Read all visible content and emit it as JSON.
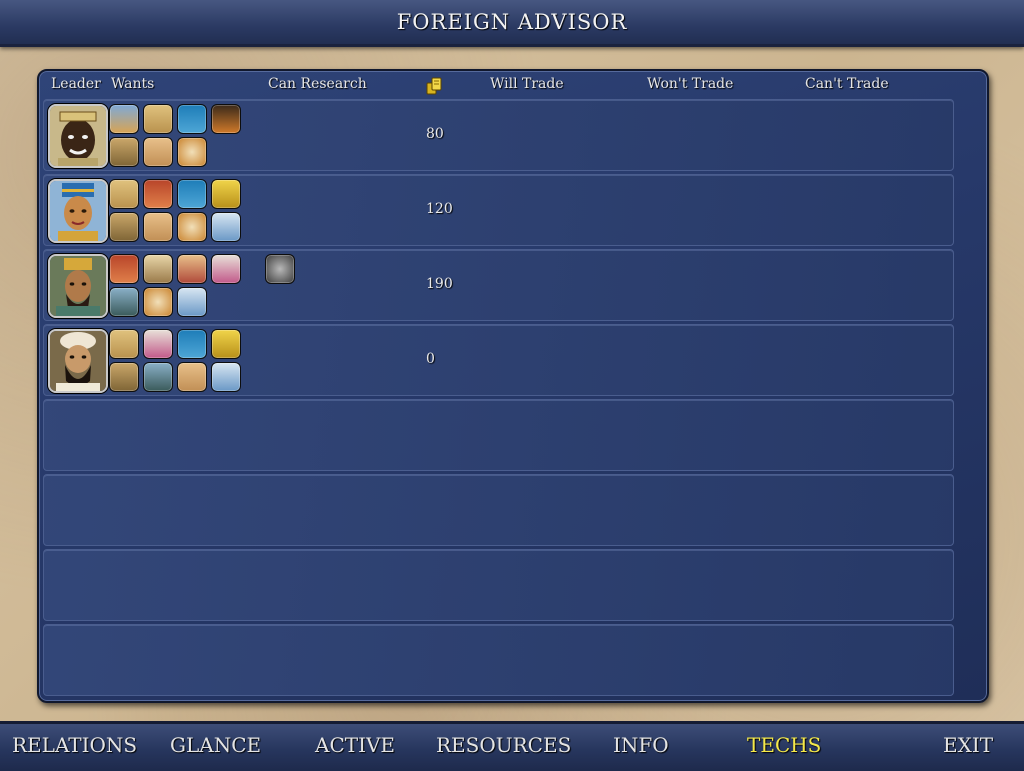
{
  "title": "FOREIGN ADVISOR",
  "columns": {
    "leader": "Leader",
    "wants": "Wants",
    "can_research": "Can Research",
    "gold_icon": "gold-coins-icon",
    "will_trade": "Will Trade",
    "wont_trade": "Won't Trade",
    "cant_trade": "Can't Trade"
  },
  "rows": [
    {
      "leader": "zulu-leader-portrait",
      "wants": [
        "pyramid-tech-icon",
        "tablets-tech-icon",
        "blue-figure-tech-icon",
        "mona-lisa-tech-icon",
        "mosaic-tech-icon",
        "scroll-tech-icon",
        "compass-tech-icon"
      ],
      "can_research": [],
      "gold": "80"
    },
    {
      "leader": "egyptian-leader-portrait",
      "wants": [
        "tablets-tech-icon",
        "dragon-tech-icon",
        "blue-figure-tech-icon",
        "crown-tech-icon",
        "mosaic-tech-icon",
        "scroll-tech-icon",
        "compass-tech-icon",
        "knight-tech-icon"
      ],
      "can_research": [],
      "gold": "120"
    },
    {
      "leader": "babylonian-leader-portrait",
      "wants": [
        "dragon-tech-icon",
        "map-tech-icon",
        "monk-tech-icon",
        "scroll-pink-tech-icon",
        "statue-tech-icon",
        "compass-tech-icon",
        "knight-tech-icon"
      ],
      "can_research": [
        "wheel-tech-icon"
      ],
      "gold": "190"
    },
    {
      "leader": "persian-leader-portrait",
      "wants": [
        "tablets-tech-icon",
        "scroll-pink-tech-icon",
        "blue-figure-tech-icon",
        "crown-tech-icon",
        "mosaic-tech-icon",
        "statue-tech-icon",
        "scroll-tech-icon",
        "knight-tech-icon"
      ],
      "can_research": [],
      "gold": "0"
    },
    {
      "leader": "",
      "wants": [],
      "can_research": [],
      "gold": ""
    },
    {
      "leader": "",
      "wants": [],
      "can_research": [],
      "gold": ""
    },
    {
      "leader": "",
      "wants": [],
      "can_research": [],
      "gold": ""
    },
    {
      "leader": "",
      "wants": [],
      "can_research": [],
      "gold": ""
    }
  ],
  "nav": {
    "relations": "RELATIONS",
    "glance": "GLANCE",
    "active": "ACTIVE",
    "resources": "RESOURCES",
    "info": "INFO",
    "techs": "TECHS",
    "exit": "EXIT"
  },
  "colors": {
    "active_tab": "#f5e94a",
    "panel": "#27396a"
  }
}
